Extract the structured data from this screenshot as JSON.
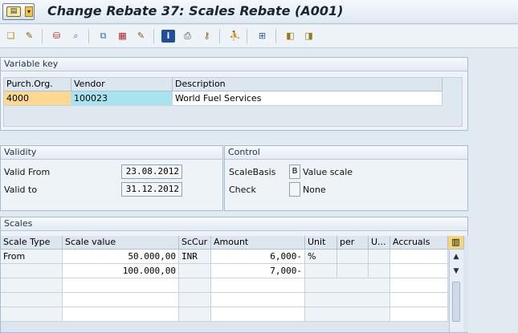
{
  "window": {
    "title": "Change Rebate 37: Scales Rebate (A001)"
  },
  "variable_key": {
    "heading": "Variable key",
    "columns": [
      "Purch.Org.",
      "Vendor",
      "Description"
    ],
    "row": {
      "purch_org": "4000",
      "vendor": "100023",
      "description": "World Fuel Services"
    }
  },
  "validity": {
    "heading": "Validity",
    "valid_from_label": "Valid From",
    "valid_from": "23.08.2012",
    "valid_to_label": "Valid to",
    "valid_to": "31.12.2012"
  },
  "control": {
    "heading": "Control",
    "scale_basis_label": "ScaleBasis",
    "scale_basis_code": "B",
    "scale_basis_text": "Value scale",
    "check_label": "Check",
    "check_code": "",
    "check_text": "None"
  },
  "scales": {
    "heading": "Scales",
    "columns": [
      "Scale Type",
      "Scale value",
      "ScCur",
      "Amount",
      "Unit",
      "per",
      "U...",
      "Accruals"
    ],
    "rows": [
      {
        "scale_type": "From",
        "scale_value": "50.000,00",
        "sccur": "INR",
        "amount": "6,000-",
        "unit": "%",
        "per": "",
        "u": "",
        "accruals": ""
      },
      {
        "scale_type": "",
        "scale_value": "100.000,00",
        "sccur": "",
        "amount": "7,000-",
        "unit": "",
        "per": "",
        "u": "",
        "accruals": ""
      }
    ]
  }
}
